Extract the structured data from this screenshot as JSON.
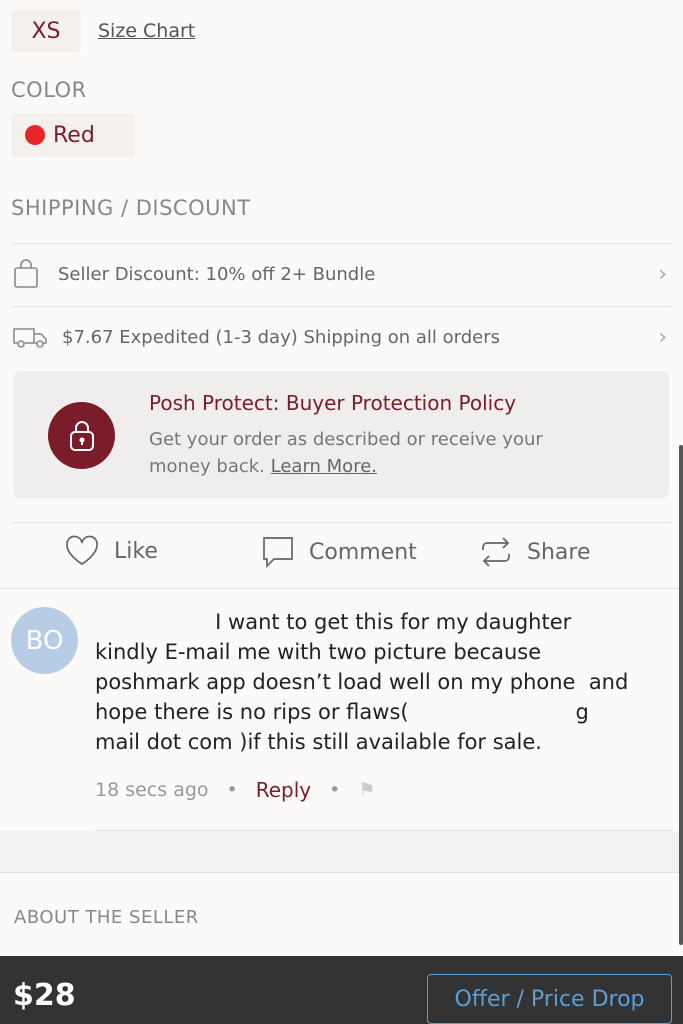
{
  "size": {
    "selected": "XS",
    "size_chart": "Size Chart"
  },
  "color": {
    "label": "COLOR",
    "value": "Red",
    "swatch": "#e8252b"
  },
  "shipping": {
    "label": "SHIPPING / DISCOUNT",
    "discount": "Seller Discount: 10% off 2+ Bundle",
    "shipping": "$7.67 Expedited (1-3 day) Shipping on all orders"
  },
  "protect": {
    "title": "Posh Protect: Buyer Protection Policy",
    "line1": "Get your order as described or receive your",
    "line2": "money back. ",
    "link": "Learn More.",
    "accent": "#7b1c2b"
  },
  "actions": {
    "like": "Like",
    "comment": "Comment",
    "share": "Share"
  },
  "comment": {
    "avatar": "BO",
    "lines": [
      "                  I want to get this for my daughter",
      "kindly E-mail me with two picture because",
      "poshmark app doesn’t load well on my phone  and",
      "hope there is no rips or flaws(                         g",
      "mail dot com )if this still available for sale."
    ],
    "time": "18 secs ago",
    "reply": "Reply"
  },
  "about": "ABOUT THE SELLER",
  "footer": {
    "price": "$28",
    "offer": "Offer / Price Drop"
  }
}
